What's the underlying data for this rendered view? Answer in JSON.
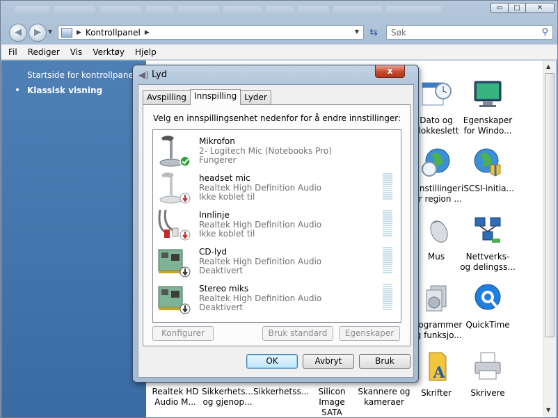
{
  "explorer": {
    "address": {
      "segment": "Kontrollpanel"
    },
    "search": {
      "placeholder": "Søk"
    },
    "window_buttons": {
      "minimize": "▭",
      "maximize": "□",
      "close": "✕"
    },
    "menu": [
      "Fil",
      "Rediger",
      "Vis",
      "Verktøy",
      "Hjelp"
    ],
    "sidebar": {
      "home_link": "Startside for kontrollpanel",
      "classic_view": "Klassisk visning"
    },
    "items": [
      {
        "line1": "Dato og",
        "line2": "klokkeslett",
        "icon": "calendar-clock-icon"
      },
      {
        "line1": "Egenskaper",
        "line2": "for Windo...",
        "icon": "monitor-icon"
      },
      {
        "line1": "Innstillinger",
        "line2": "for region ...",
        "icon": "globe-clock-icon"
      },
      {
        "line1": "iSCSI-initia...",
        "line2": "",
        "icon": "globe-network-icon"
      },
      {
        "line1": "Mus",
        "line2": "",
        "icon": "mouse-icon"
      },
      {
        "line1": "Nettverks-",
        "line2": "og delingss...",
        "icon": "network-icon"
      },
      {
        "line1": "Programmer",
        "line2": "og funksjo...",
        "icon": "programs-icon"
      },
      {
        "line1": "QuickTime",
        "line2": "",
        "icon": "quicktime-icon"
      },
      {
        "line1": "Skrifter",
        "line2": "",
        "icon": "fonts-icon"
      },
      {
        "line1": "Skrivere",
        "line2": "",
        "icon": "printer-icon"
      },
      {
        "line1": "Realtek HD",
        "line2": "Audio M..."
      },
      {
        "line1": "Sikkerhets...",
        "line2": "og gjenop..."
      },
      {
        "line1": "Sikkerhetss...",
        "line2": ""
      },
      {
        "line1": "Silicon Image",
        "line2": "SATA Contr..."
      },
      {
        "line1": "Skannere og",
        "line2": "kameraer"
      }
    ]
  },
  "dialog": {
    "title": "Lyd",
    "close_label": "x",
    "tabs": [
      "Avspilling",
      "Innspilling",
      "Lyder"
    ],
    "active_tab": "Innspilling",
    "instruction": "Velg en innspillingsenhet nedenfor for å endre innstillinger:",
    "devices": [
      {
        "name": "Mikrofon",
        "sub": "2- Logitech Mic (Notebooks Pro)",
        "status": "Fungerer",
        "icon": "microphone-icon",
        "badge": "check"
      },
      {
        "name": "headset mic",
        "sub": "Realtek High Definition Audio",
        "status": "Ikke koblet til",
        "icon": "microphone-icon",
        "badge": "unplugged"
      },
      {
        "name": "Innlinje",
        "sub": "Realtek High Definition Audio",
        "status": "Ikke koblet til",
        "icon": "rca-cable-icon",
        "badge": "unplugged"
      },
      {
        "name": "CD-lyd",
        "sub": "Realtek High Definition Audio",
        "status": "Deaktivert",
        "icon": "sound-card-icon",
        "badge": "disabled"
      },
      {
        "name": "Stereo miks",
        "sub": "Realtek High Definition Audio",
        "status": "Deaktivert",
        "icon": "sound-card-icon",
        "badge": "disabled"
      }
    ],
    "buttons": {
      "configure": "Konfigurer",
      "set_default": "Bruk standard",
      "properties": "Egenskaper",
      "ok": "OK",
      "cancel": "Avbryt",
      "apply": "Bruk"
    }
  }
}
